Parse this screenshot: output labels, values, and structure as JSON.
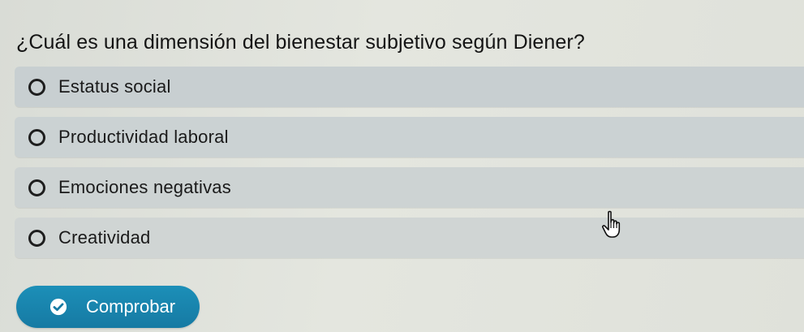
{
  "question": {
    "text": "¿Cuál es una dimensión del bienestar subjetivo según Diener?"
  },
  "options": [
    {
      "label": "Estatus social"
    },
    {
      "label": "Productividad laboral"
    },
    {
      "label": "Emociones negativas"
    },
    {
      "label": "Creatividad"
    }
  ],
  "submit": {
    "label": "Comprobar",
    "icon": "check-circle-icon"
  },
  "pointer": {
    "icon": "hand-pointer-icon"
  },
  "colors": {
    "accent": "#1784ad",
    "option_background": "#cbd2d3",
    "page_background": "#e2e4dd"
  }
}
